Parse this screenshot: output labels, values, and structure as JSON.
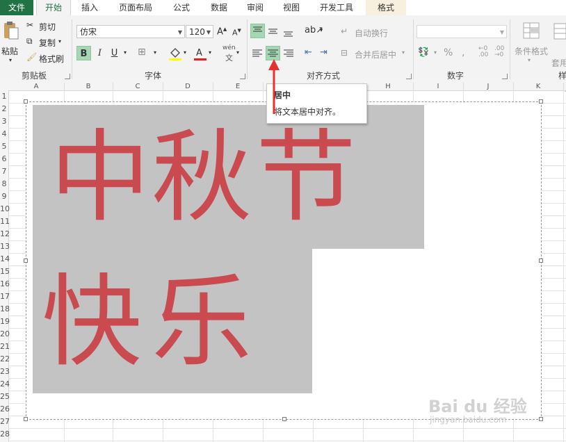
{
  "tabs": [
    "文件",
    "开始",
    "插入",
    "页面布局",
    "公式",
    "数据",
    "审阅",
    "视图",
    "开发工具",
    "格式"
  ],
  "active_tab": "开始",
  "colors": {
    "file_tab": "#217346",
    "accent": "#217346",
    "highlight": "#a6d7b3",
    "text_red": "#c94a4f",
    "block_gray": "#c3c3c3",
    "arrow_red": "#e8302f"
  },
  "clipboard": {
    "paste": "粘贴",
    "cut": "剪切",
    "copy": "复制",
    "format_painter": "格式刷",
    "label": "剪贴板"
  },
  "font": {
    "name": "仿宋",
    "size": "120",
    "bold": "B",
    "italic": "I",
    "underline": "U",
    "phonetic": "wén",
    "label": "字体"
  },
  "alignment": {
    "wrap_text": "自动换行",
    "merge_center": "合并后居中",
    "label": "对齐方式"
  },
  "number": {
    "percent": "%",
    "label": "数字"
  },
  "styles": {
    "conditional": "条件格式",
    "table_format": "套用表格格式",
    "label": "样式"
  },
  "tooltip": {
    "title": "居中",
    "desc": "将文本居中对齐。"
  },
  "columns": [
    "A",
    "B",
    "C",
    "D",
    "E",
    "F",
    "G",
    "H",
    "I",
    "J",
    "K"
  ],
  "rows": [
    "1",
    "2",
    "3",
    "4",
    "5",
    "6",
    "7",
    "8",
    "9",
    "10",
    "11",
    "12",
    "13",
    "14",
    "15",
    "16",
    "17",
    "18",
    "19",
    "20",
    "21",
    "22",
    "23",
    "24",
    "25",
    "26",
    "27",
    "28"
  ],
  "picture": {
    "line1": [
      "中",
      "秋",
      "节"
    ],
    "line2": [
      "快",
      "乐"
    ]
  },
  "watermark": {
    "brand": "Bai du 经验",
    "url": "jingyan.baidu.com"
  }
}
